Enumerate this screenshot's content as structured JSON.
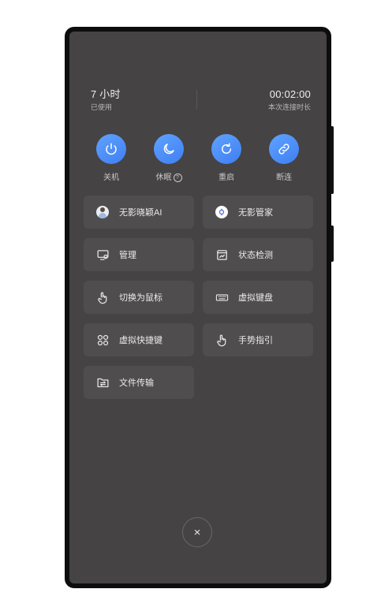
{
  "usage": {
    "value": "7 小时",
    "label": "已使用"
  },
  "connection": {
    "value": "00:02:00",
    "label": "本次连接时长"
  },
  "quick_actions": [
    {
      "label": "关机",
      "icon": "power-icon"
    },
    {
      "label": "休眠",
      "icon": "moon-icon",
      "help": "?"
    },
    {
      "label": "重启",
      "icon": "refresh-icon"
    },
    {
      "label": "断连",
      "icon": "link-icon"
    }
  ],
  "menu": [
    {
      "label": "无影晓颖AI",
      "icon": "ai-avatar-icon"
    },
    {
      "label": "无影管家",
      "icon": "manager-icon"
    },
    {
      "label": "管理",
      "icon": "monitor-manage-icon"
    },
    {
      "label": "状态检测",
      "icon": "status-check-icon"
    },
    {
      "label": "切换为鼠标",
      "icon": "hand-pointer-icon"
    },
    {
      "label": "虚拟键盘",
      "icon": "keyboard-icon"
    },
    {
      "label": "虚拟快捷键",
      "icon": "shortcut-grid-icon"
    },
    {
      "label": "手势指引",
      "icon": "gesture-icon"
    },
    {
      "label": "文件传输",
      "icon": "file-transfer-icon"
    }
  ],
  "close": {
    "symbol": "×"
  },
  "colors": {
    "accent": "#4f8ff7",
    "screen_bg": "#454343",
    "card_bg": "#4f4d4d"
  }
}
